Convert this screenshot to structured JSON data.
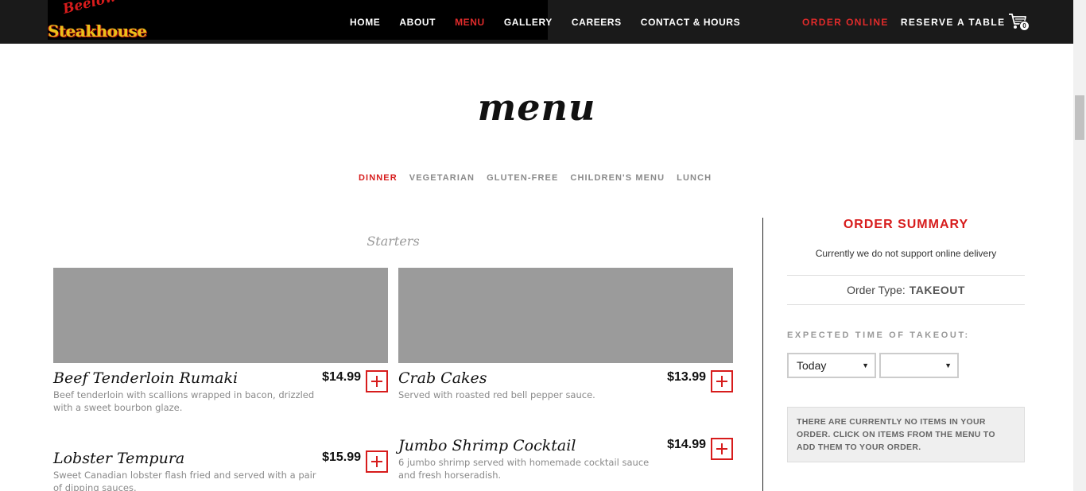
{
  "logo": {
    "script_text": "Beelow's",
    "main_text": "Steakhouse"
  },
  "nav": {
    "main": [
      {
        "label": "HOME",
        "active": false
      },
      {
        "label": "ABOUT",
        "active": false
      },
      {
        "label": "MENU",
        "active": true
      },
      {
        "label": "GALLERY",
        "active": false
      },
      {
        "label": "CAREERS",
        "active": false
      },
      {
        "label": "CONTACT & HOURS",
        "active": false
      }
    ],
    "order_online": "ORDER ONLINE",
    "reserve": "RESERVE A TABLE",
    "cart_count": "0",
    "cart_icon": "cart-icon"
  },
  "page": {
    "title": "menu"
  },
  "tabs": [
    {
      "label": "DINNER",
      "active": true
    },
    {
      "label": "VEGETARIAN",
      "active": false
    },
    {
      "label": "GLUTEN-FREE",
      "active": false
    },
    {
      "label": "CHILDREN'S MENU",
      "active": false
    },
    {
      "label": "LUNCH",
      "active": false
    }
  ],
  "section": {
    "title": "Starters"
  },
  "items": [
    {
      "name": "Beef Tenderloin Rumaki",
      "price": "$14.99",
      "description": "Beef tenderloin with scallions wrapped in bacon, drizzled with a sweet bourbon glaze."
    },
    {
      "name": "Crab Cakes",
      "price": "$13.99",
      "description": "Served with roasted red bell pepper sauce."
    },
    {
      "name": "Lobster Tempura",
      "price": "$15.99",
      "description": "Sweet Canadian lobster flash fried and served with a pair of dipping sauces."
    },
    {
      "name": "Jumbo Shrimp Cocktail",
      "price": "$14.99",
      "description": "6 jumbo shrimp served with homemade cocktail sauce and fresh horseradish."
    }
  ],
  "summary": {
    "title": "ORDER SUMMARY",
    "note": "Currently we do not support online delivery",
    "order_type_label": "Order Type:",
    "order_type_value": "TAKEOUT",
    "expected_label": "EXPECTED TIME OF TAKEOUT:",
    "day_select": "Today",
    "time_select": "",
    "empty_message": "THERE ARE CURRENTLY NO ITEMS IN YOUR ORDER. CLICK ON ITEMS FROM THE MENU TO ADD THEM TO YOUR ORDER."
  },
  "colors": {
    "accent": "#d71c1c",
    "topbar": "#1a1a1a",
    "placeholder_image": "#9b9b9b"
  }
}
